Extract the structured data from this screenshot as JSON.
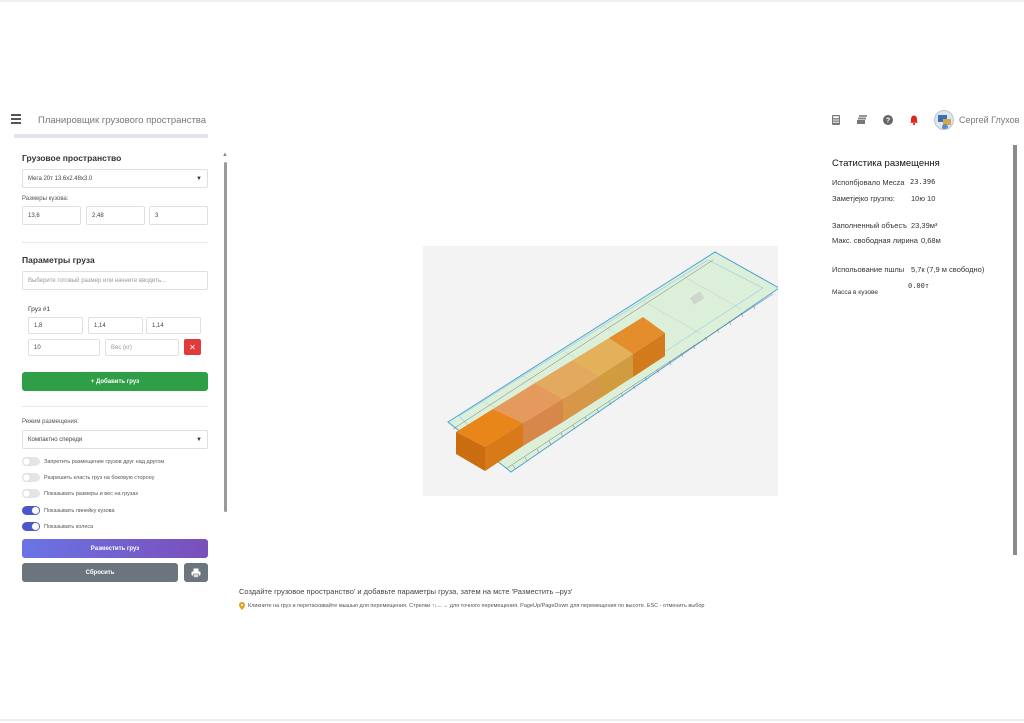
{
  "header": {
    "app_title": "Планировщик грузового пространства",
    "user_name": "Сергей Глухов",
    "icons": [
      "menu-icon",
      "calculator-icon",
      "stack-icon",
      "help-icon",
      "bell-icon",
      "avatar"
    ],
    "bell_color": "#e02424"
  },
  "sidebar": {
    "space_title": "Грузовое пространство",
    "space_select_value": "Мега 20т 13.6x2.48x3.0",
    "body_dims_label": "Размеры кузова:",
    "body_dims": [
      "13,6",
      "2,48",
      "3"
    ],
    "cargo_params_title": "Параметры груза",
    "cargo_search_placeholder": "Выберите готовый размер или начните вводить...",
    "cargo_item": {
      "title": "Груз #1",
      "dims": [
        "1,8",
        "1,14",
        "1,14"
      ],
      "quantity": "10",
      "weight_placeholder": "Вес (кг)",
      "delete_glyph": "✕"
    },
    "add_cargo_label": "+ Добавить груз",
    "mode_label": "Режим размещения:",
    "mode_value": "Компактно спереди",
    "toggles": [
      {
        "label": "Запретить размещение грузов друг над другом",
        "on": false
      },
      {
        "label": "Разрешить класть груз на боковую сторону",
        "on": false
      },
      {
        "label": "Показывать размеры и вес на грузах",
        "on": false
      },
      {
        "label": "Показывать линейку кузова",
        "on": true
      },
      {
        "label": "Показывать колеса",
        "on": true
      }
    ],
    "place_button_label": "Разместить груз",
    "reset_button_label": "Сбросить",
    "print_icon": "print-icon",
    "accent_colors": {
      "green": "#2e9e47",
      "purple_start": "#6a74e6",
      "purple_end": "#7b4fb8",
      "danger": "#e03b3b",
      "toggle_on": "#4a57c9"
    }
  },
  "stats": {
    "title": "Статистика размещення",
    "rows": [
      {
        "label": "Испопбјовало Mecza",
        "value": "23.396"
      },
      {
        "label": "Заметјејко грузгю:",
        "value": "10ю 10"
      },
      {
        "label": "Заполненный объесъ",
        "value": "23,39м³"
      },
      {
        "label": "Макс. свободная лирина",
        "value": "0,68м"
      },
      {
        "label": "Испольование пшлы",
        "value": "5,7к   (7,9 м свободно)"
      },
      {
        "label": "",
        "value": "0.00т"
      },
      {
        "label": "Масса в кузове",
        "value": ""
      }
    ]
  },
  "viewport": {
    "box_colors": [
      "#e8861a",
      "#e39a5c",
      "#e3a95e",
      "#e2b159",
      "#e48d2c"
    ],
    "container_color": "#cfe6cc",
    "outline_color": "#4aa3d8"
  },
  "footer": {
    "instruction": "Создайте грузовое пространство' и добавьте параметры груза, затем на   мсте 'Разместить –руз'",
    "hint": "Кликните на груз и перетаскивайте мышью для перемещения. Стрелки ↑↓←→ для точного перемещения. PageUp/PageDown для перемещения по высоте. ESC - отменить выбор"
  }
}
